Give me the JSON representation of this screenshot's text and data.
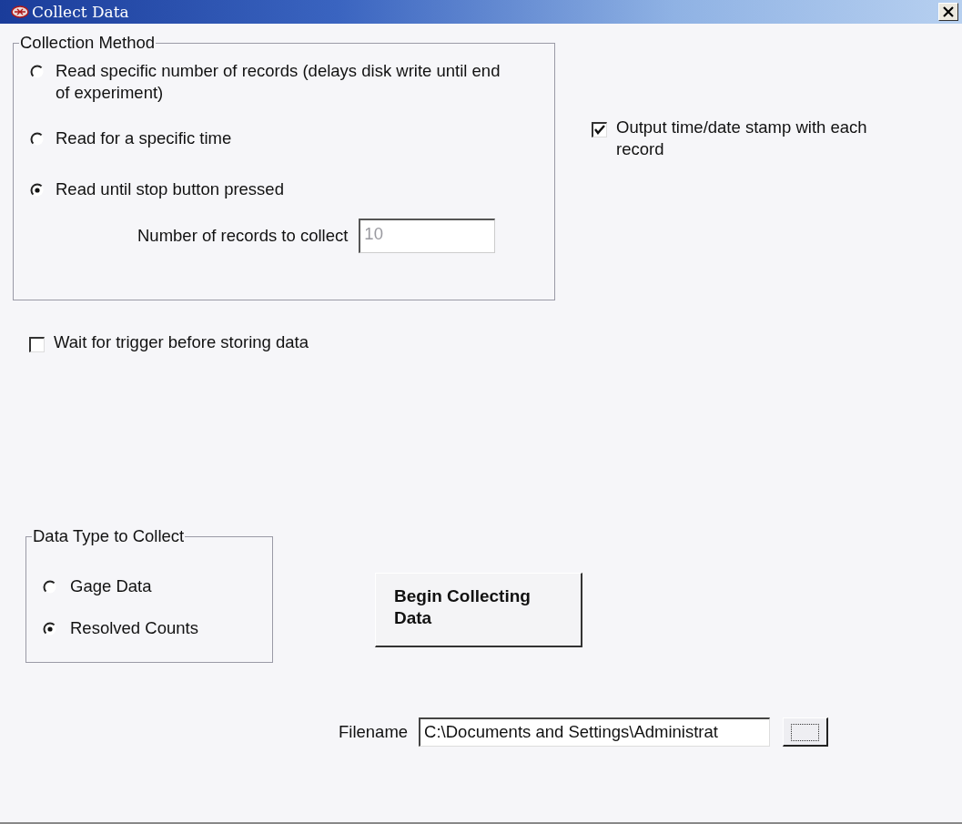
{
  "window": {
    "title": "Collect Data"
  },
  "collection_method": {
    "label": "Collection Method",
    "options": [
      {
        "label": "Read specific number of records (delays disk write until end of experiment)",
        "selected": false
      },
      {
        "label": "Read for a specific time",
        "selected": false
      },
      {
        "label": "Read until stop button pressed",
        "selected": true
      }
    ],
    "records_field": {
      "label": "Number of records to collect",
      "value": "10",
      "disabled": true
    }
  },
  "output_timestamp": {
    "label": "Output time/date stamp with each record",
    "checked": true
  },
  "wait_for_trigger": {
    "label": "Wait for trigger before storing data",
    "checked": false
  },
  "data_type": {
    "label": "Data Type to Collect",
    "options": [
      {
        "label": "Gage Data",
        "selected": false
      },
      {
        "label": "Resolved Counts",
        "selected": true
      }
    ]
  },
  "begin_button": {
    "label": "Begin Collecting Data"
  },
  "filename": {
    "label": "Filename",
    "value": "C:\\Documents and Settings\\Administrat"
  }
}
